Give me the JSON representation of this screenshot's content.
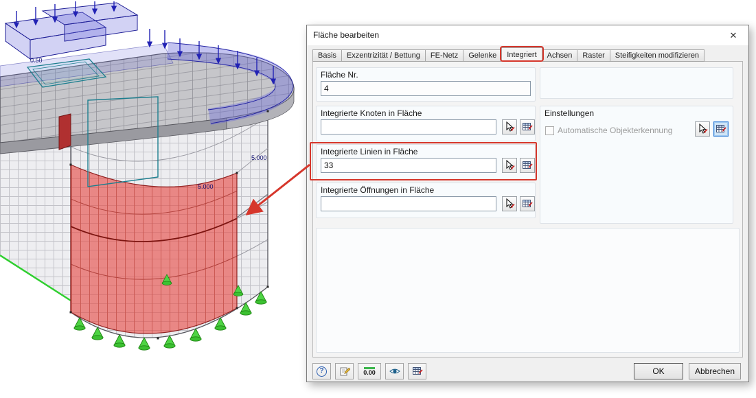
{
  "viewport": {
    "labels": {
      "slab_thickness": "0.50",
      "height_right": "5.000",
      "height_front": "5.000"
    }
  },
  "dialog": {
    "title": "Fläche bearbeiten",
    "tabs": [
      {
        "label": "Basis"
      },
      {
        "label": "Exzentrizität / Bettung"
      },
      {
        "label": "FE-Netz"
      },
      {
        "label": "Gelenke"
      },
      {
        "label": "Integriert"
      },
      {
        "label": "Achsen"
      },
      {
        "label": "Raster"
      },
      {
        "label": "Steifigkeiten modifizieren"
      }
    ],
    "active_tab": "Integriert",
    "fields": {
      "surface_no": {
        "label": "Fläche Nr.",
        "value": "4"
      },
      "nodes": {
        "label": "Integrierte Knoten in Fläche",
        "value": ""
      },
      "lines": {
        "label": "Integrierte Linien in Fläche",
        "value": "33"
      },
      "openings": {
        "label": "Integrierte Öffnungen in Fläche",
        "value": ""
      }
    },
    "settings": {
      "label": "Einstellungen",
      "auto_detect_label": "Automatische Objekterkennung",
      "auto_detect_checked": false
    },
    "footer": {
      "ok": "OK",
      "cancel": "Abbrechen",
      "decimals_label": "0.00"
    }
  },
  "icons": {
    "close": "✕",
    "help": "?"
  },
  "colors": {
    "selection_fill": "#e84c46",
    "annotation_red": "#d6362b",
    "load_blue": "#2222b4",
    "support_green": "#3cc132",
    "active_pick_border": "#2f7cd6"
  }
}
